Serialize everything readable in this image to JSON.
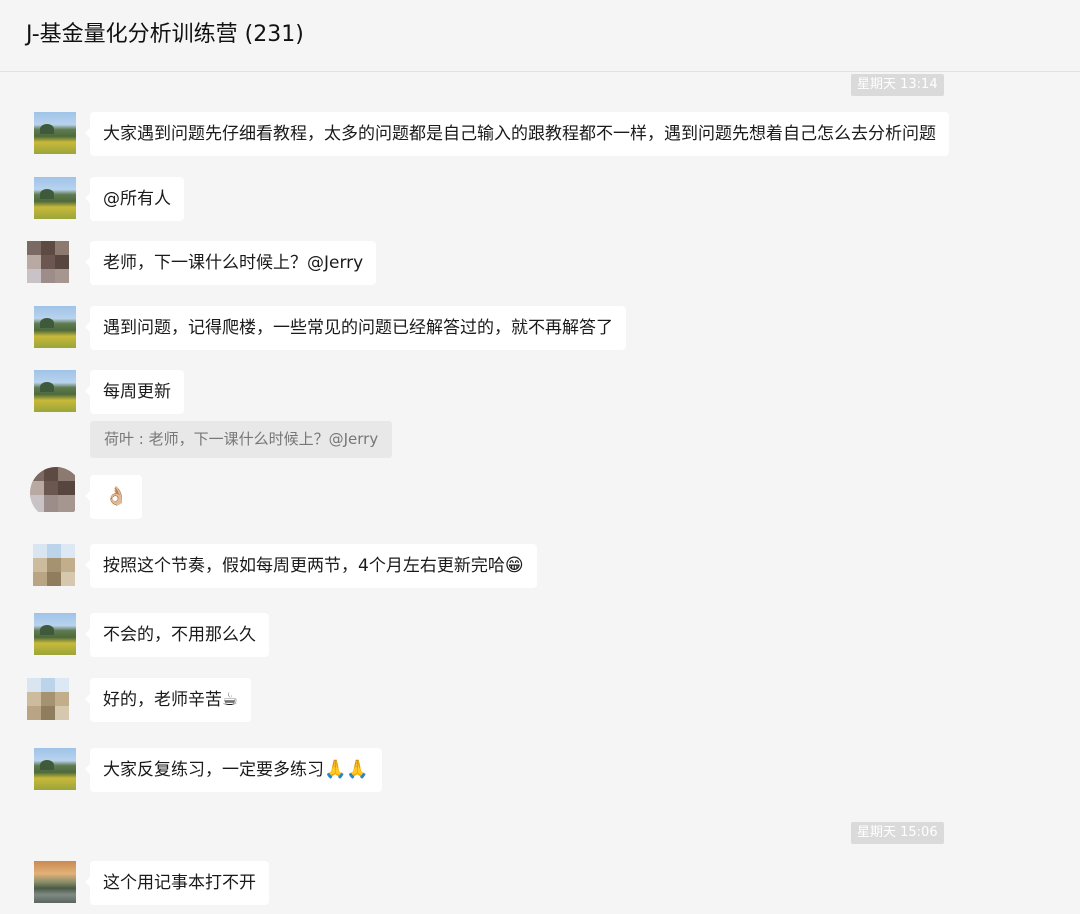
{
  "header": {
    "title": "J-基金量化分析训练营 (231)"
  },
  "separators": {
    "first": "星期天 13:14",
    "second": "星期天 15:06"
  },
  "messages": [
    {
      "text": "大家遇到问题先仔细看教程，太多的问题都是自己输入的跟教程都不一样，遇到问题先想着自己怎么去分析问题"
    },
    {
      "text": "@所有人"
    },
    {
      "text": "老师，下一课什么时候上？@Jerry"
    },
    {
      "text": "遇到问题，记得爬楼，一些常见的问题已经解答过的，就不再解答了"
    },
    {
      "text": "每周更新",
      "quote": "荷叶 : 老师，下一课什么时候上？@Jerry"
    },
    {
      "text": "👌🏼"
    },
    {
      "text": "按照这个节奏，假如每周更两节，4个月左右更新完哈",
      "emoji": "😁"
    },
    {
      "text": "不会的，不用那么久"
    },
    {
      "text": "好的，老师辛苦",
      "emoji": "☕"
    },
    {
      "text": "大家反复练习，一定要多练习",
      "emoji": "🙏🙏"
    },
    {
      "text": "这个用记事本打不开"
    }
  ]
}
